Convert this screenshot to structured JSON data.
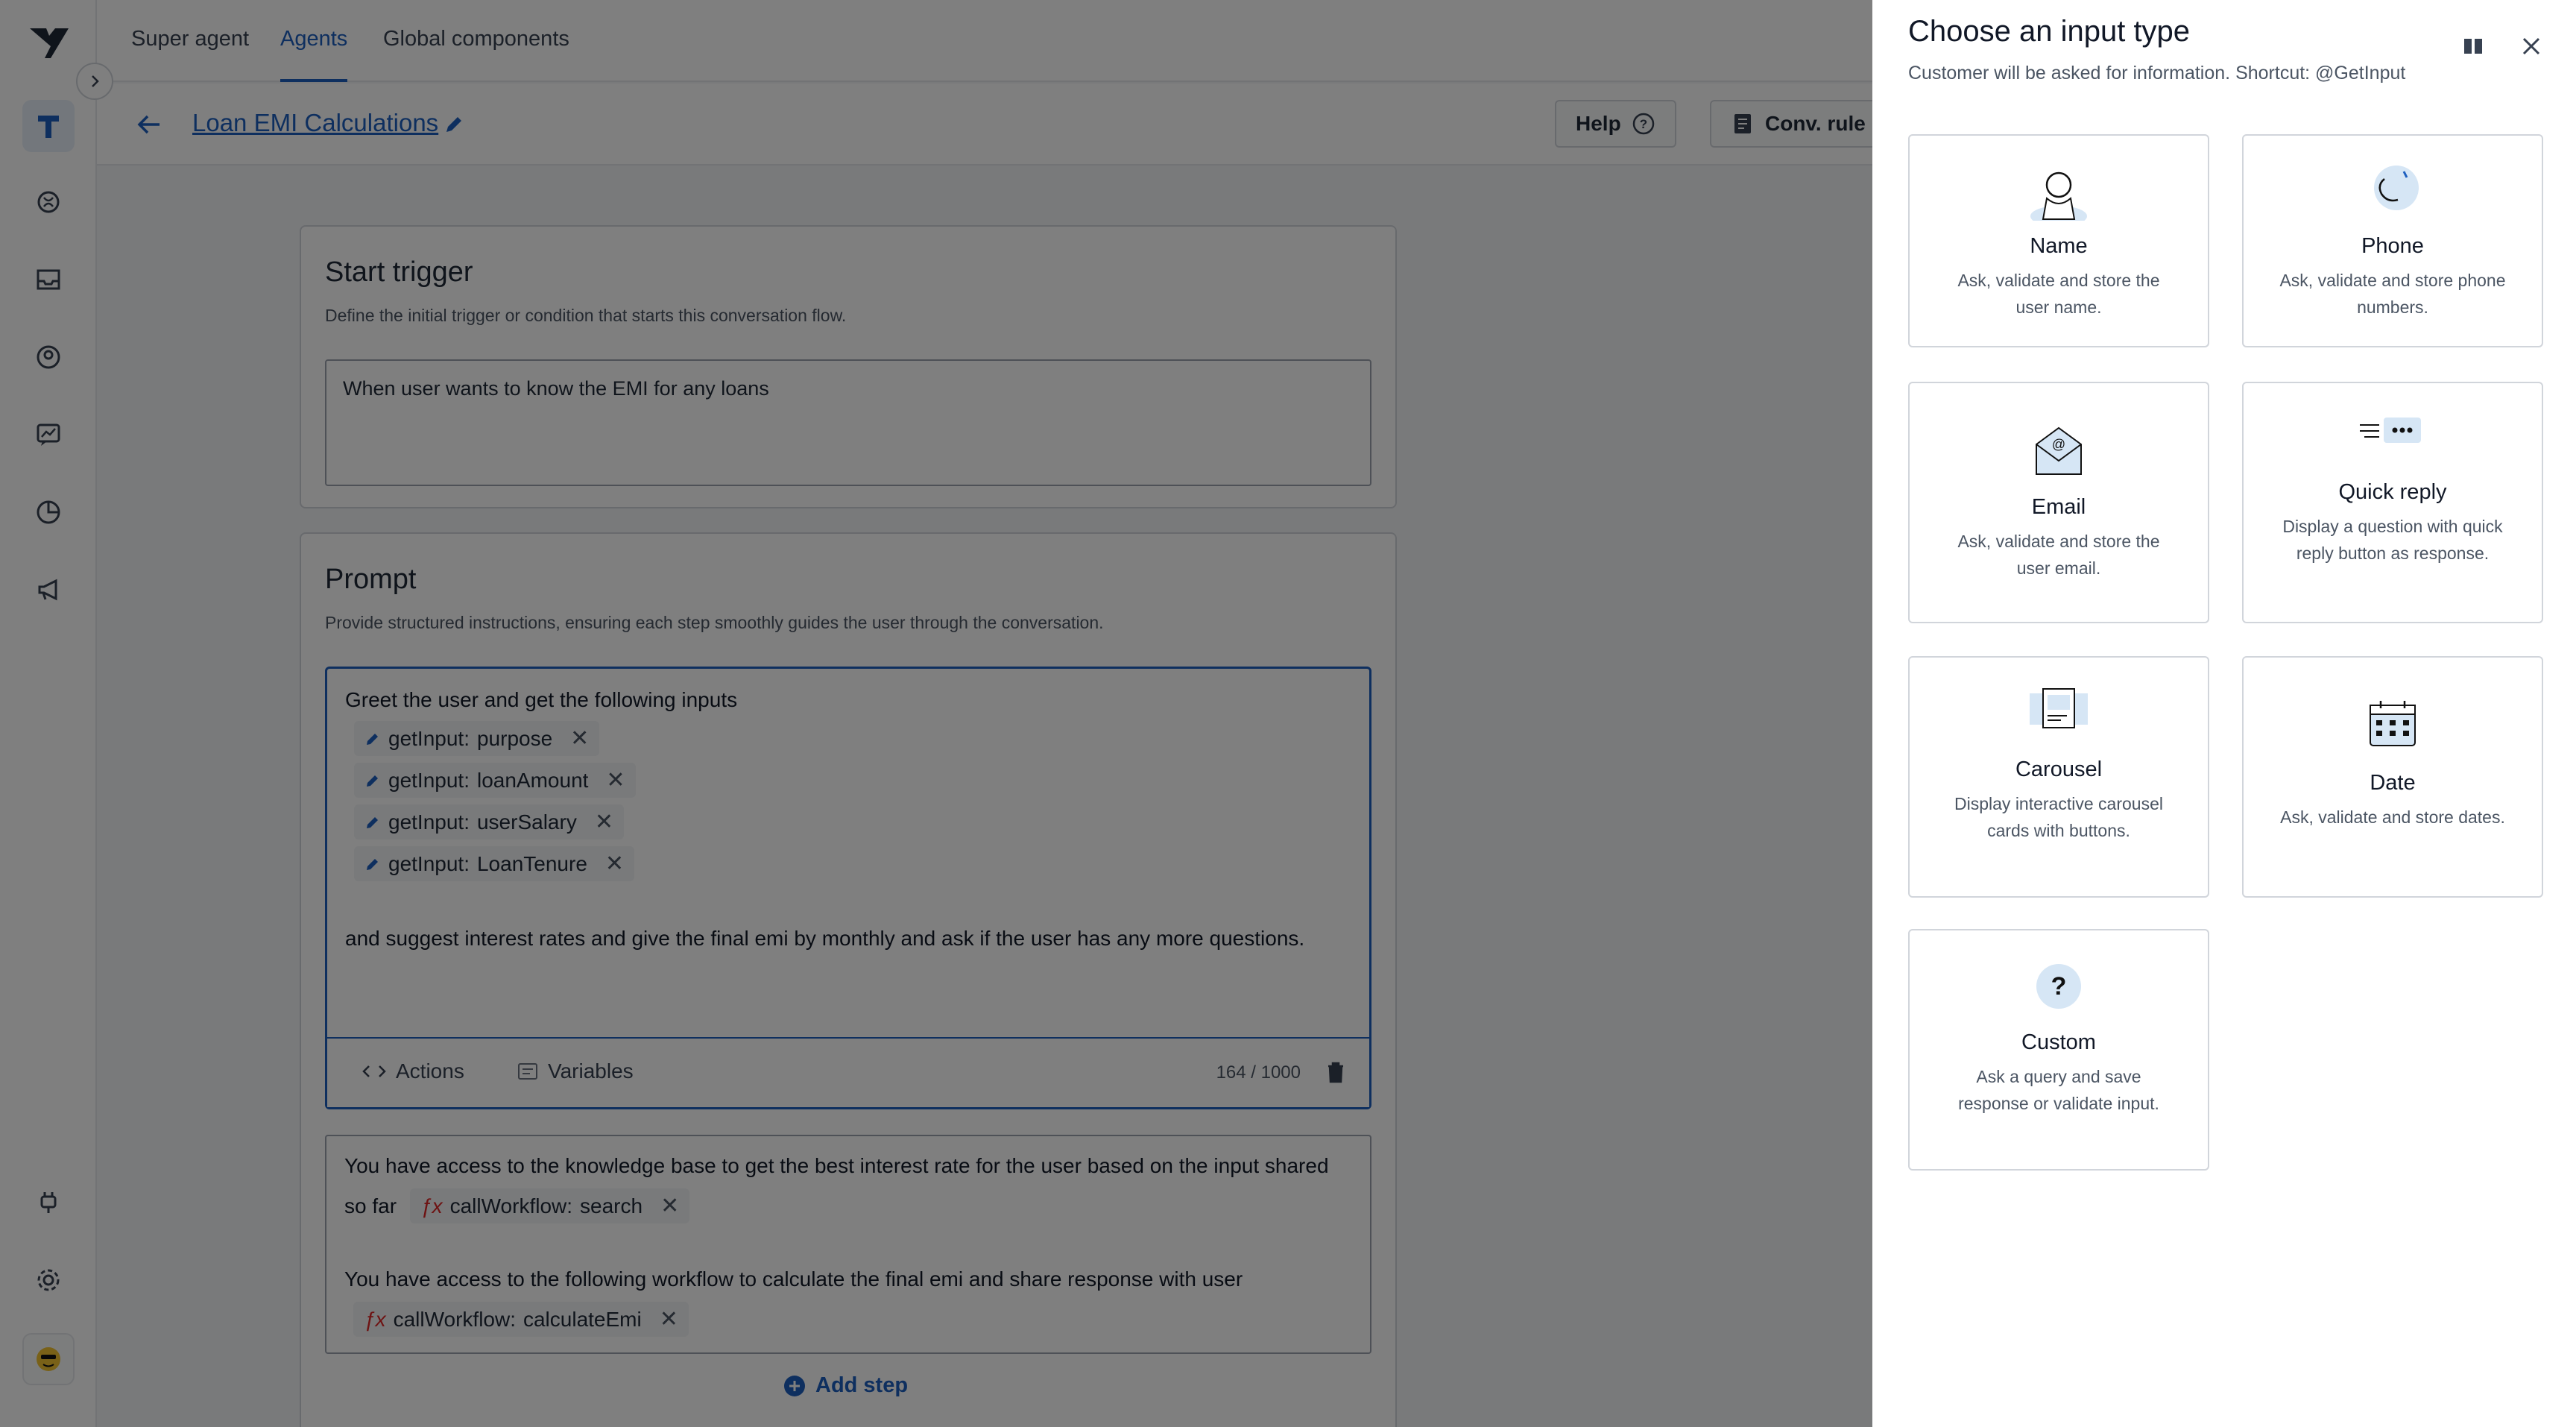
{
  "nav": {
    "tabs": [
      {
        "label": "Super agent"
      },
      {
        "label": "Agents"
      },
      {
        "label": "Global components"
      }
    ]
  },
  "page": {
    "title": "Loan EMI Calculations",
    "help_label": "Help",
    "conv_rules_label": "Conv. rule"
  },
  "start_trigger": {
    "heading": "Start trigger",
    "description": "Define the initial trigger or condition that starts this conversation flow.",
    "value": "When user wants to know the EMI for any loans"
  },
  "prompt": {
    "heading": "Prompt",
    "description": "Provide structured instructions, ensuring each step smoothly guides the user through the conversation.",
    "intro": "Greet the user and get the following inputs",
    "inputs": [
      {
        "type": "getInput:",
        "name": "purpose"
      },
      {
        "type": "getInput:",
        "name": "loanAmount"
      },
      {
        "type": "getInput:",
        "name": "userSalary"
      },
      {
        "type": "getInput:",
        "name": "LoanTenure"
      }
    ],
    "outro": "and suggest interest rates and give the final emi by monthly and ask if the user has any more questions.",
    "actions_label": "Actions",
    "variables_label": "Variables",
    "counter": "164 / 1000"
  },
  "step2": {
    "line1": "You have access to the knowledge base to get the best interest rate for the user based on the input shared",
    "line1b": "so far",
    "wf1_type": "callWorkflow:",
    "wf1_name": "search",
    "line2": "You have access to the following workflow to calculate the final emi and share response with user",
    "wf2_type": "callWorkflow:",
    "wf2_name": "calculateEmi"
  },
  "add_step_label": "Add step",
  "drawer": {
    "title": "Choose an input type",
    "subtitle": "Customer will be asked for information. Shortcut: @GetInput",
    "options": [
      {
        "title": "Name",
        "desc": "Ask, validate and store the user name.",
        "icon": "person-icon"
      },
      {
        "title": "Phone",
        "desc": "Ask, validate and store phone numbers.",
        "icon": "phone-icon"
      },
      {
        "title": "Email",
        "desc": "Ask, validate and store the user email.",
        "icon": "email-icon"
      },
      {
        "title": "Quick reply",
        "desc": "Display a question with quick reply button as response.",
        "icon": "quick-reply-icon"
      },
      {
        "title": "Carousel",
        "desc": "Display interactive carousel cards with buttons.",
        "icon": "carousel-icon"
      },
      {
        "title": "Date",
        "desc": "Ask, validate and store dates.",
        "icon": "calendar-icon"
      },
      {
        "title": "Custom",
        "desc": "Ask a query and save response or validate input.",
        "icon": "question-icon"
      }
    ]
  },
  "colors": {
    "accent": "#1d5fbf",
    "overlay": "rgba(0,0,0,0.5)",
    "chip_red": "#dc2626"
  }
}
